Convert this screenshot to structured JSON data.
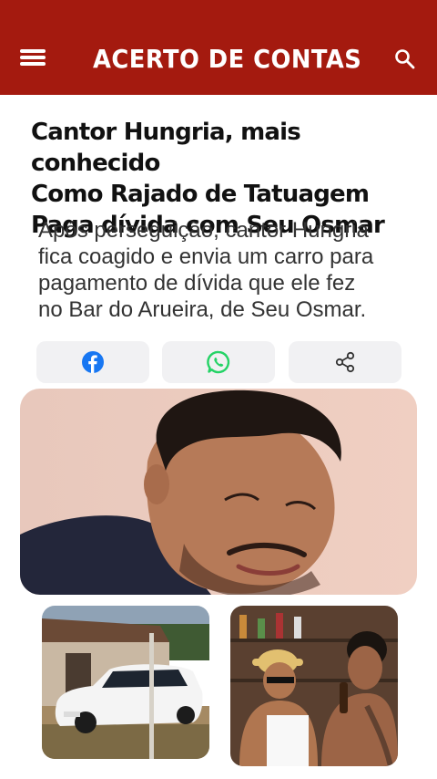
{
  "header": {
    "menu_icon": "hamburger-menu-icon",
    "title": "ACERTO DE CONTAS",
    "search_icon": "search-icon",
    "background_color": "#a41a0f"
  },
  "article": {
    "headline_lines": [
      "Cantor Hungria, mais conhecido",
      "Como Rajado de Tatuagem",
      "Paga dívida com Seu Osmar"
    ],
    "subtitle_lines": [
      "Após perseguição, cantor Hungria",
      "fica coagido e envia um carro para",
      "pagamento de dívida que ele fez",
      "no Bar do Arueira, de Seu Osmar."
    ]
  },
  "share": {
    "buttons": [
      {
        "icon": "facebook-icon",
        "color": "#1877f2"
      },
      {
        "icon": "whatsapp-icon",
        "color": "#25d366"
      },
      {
        "icon": "share-icon",
        "color": "#333333"
      }
    ]
  },
  "images": {
    "hero": "man-crying-photo",
    "thumbnails": [
      "white-car-photo",
      "bar-scene-photo"
    ]
  }
}
